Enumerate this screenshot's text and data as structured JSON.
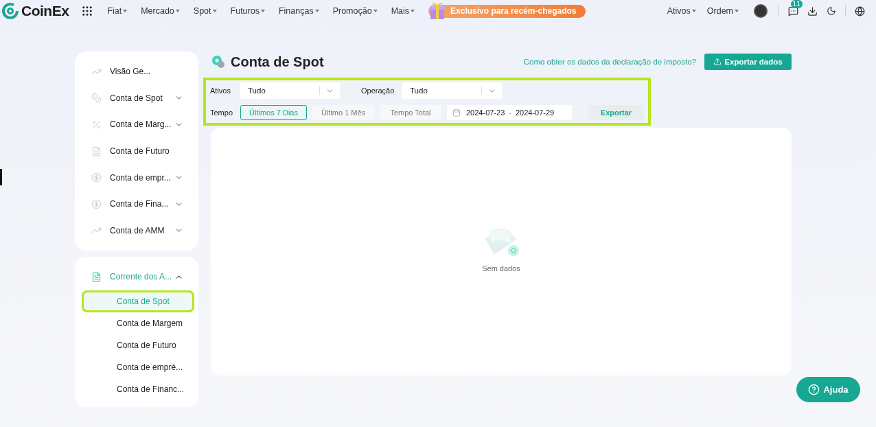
{
  "nav": {
    "logo": "CoinEx",
    "menus": [
      {
        "label": "Fiat"
      },
      {
        "label": "Mercado"
      },
      {
        "label": "Spot"
      },
      {
        "label": "Futuros"
      },
      {
        "label": "Finanças"
      },
      {
        "label": "Promoção"
      },
      {
        "label": "Mais"
      }
    ],
    "promo": "Exclusivo para recém-chegados",
    "right_menus": [
      {
        "label": "Ativos"
      },
      {
        "label": "Ordem"
      }
    ],
    "message_count": "11"
  },
  "sidebar": {
    "groups": [
      {
        "items": [
          {
            "label": "Visão Ge...",
            "kind": "chart",
            "has_children": false,
            "selected": false
          },
          {
            "label": "Conta de Spot",
            "kind": "coins",
            "has_children": true,
            "expanded": false,
            "selected": false
          },
          {
            "label": "Conta de Marg...",
            "kind": "percent",
            "has_children": true,
            "expanded": false,
            "selected": false
          },
          {
            "label": "Conta de Futuro",
            "kind": "doc",
            "has_children": false,
            "selected": false
          },
          {
            "label": "Conta de empr...",
            "kind": "coin",
            "has_children": true,
            "expanded": false,
            "selected": false
          },
          {
            "label": "Conta de Fina...",
            "kind": "coin",
            "has_children": true,
            "expanded": false,
            "selected": false
          },
          {
            "label": "Conta de AMM",
            "kind": "chart",
            "has_children": true,
            "expanded": false,
            "selected": false
          }
        ]
      },
      {
        "items": [
          {
            "label": "Corrente dos A...",
            "kind": "doc",
            "has_children": true,
            "expanded": true,
            "selected": true,
            "children": [
              {
                "label": "Conta de Spot",
                "selected": true,
                "highlighted": true
              },
              {
                "label": "Conta de Margem",
                "selected": false,
                "highlighted": false
              },
              {
                "label": "Conta de Futuro",
                "selected": false,
                "highlighted": false
              },
              {
                "label": "Conta de empré...",
                "selected": false,
                "highlighted": false
              },
              {
                "label": "Conta de Financ...",
                "selected": false,
                "highlighted": false
              }
            ]
          }
        ]
      }
    ]
  },
  "main": {
    "title": "Conta de Spot",
    "tax_link": "Como obter os dados da declaração de imposto?",
    "export_all_button": "Exportar dados",
    "filters": {
      "highlighted": true,
      "assets_label": "Ativos",
      "assets_value": "Tudo",
      "operation_label": "Operação",
      "operation_value": "Tudo",
      "time_label": "Tempo",
      "time_options": [
        {
          "label": "Últimos 7 Dias",
          "selected": true
        },
        {
          "label": "Último 1 Mês",
          "selected": false
        },
        {
          "label": "Tempo Total",
          "selected": false
        }
      ],
      "date_start": "2024-07-23",
      "date_separator": "-",
      "date_end": "2024-07-29",
      "export_button": "Exportar"
    },
    "empty_text": "Sem dados"
  },
  "help_button": "Ajuda"
}
